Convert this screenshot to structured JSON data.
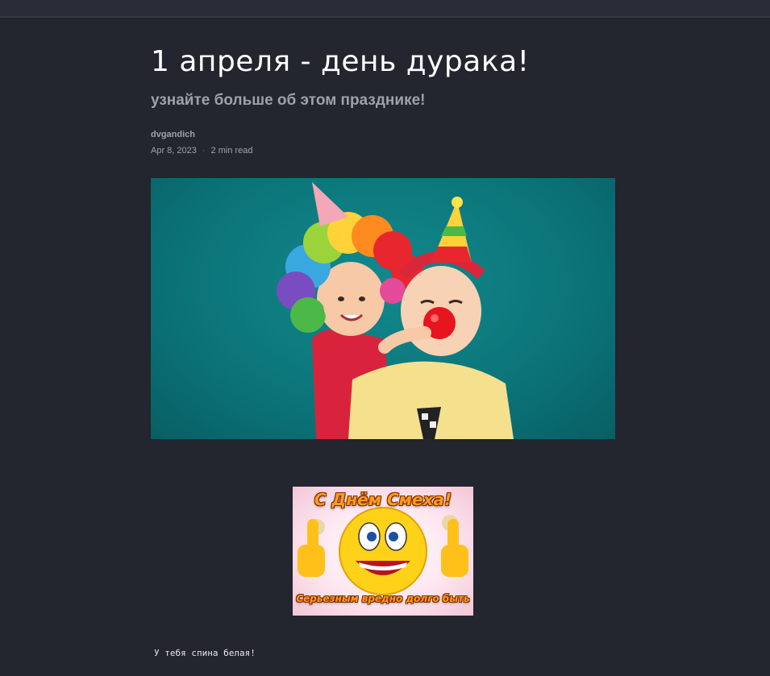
{
  "article": {
    "title": "1 апреля - день дурака!",
    "subtitle": "узнайте больше об этом празднике!",
    "author": "dvgandich",
    "date": "Apr 8, 2023",
    "separator": "·",
    "read_time": "2 min read",
    "body_text": "У тебя спина белая!"
  },
  "greeting_card": {
    "top_text": "С Днём Смеха!",
    "bottom_text": "Серьезным вредно долго быть"
  },
  "colors": {
    "page_background": "#23252f",
    "hero_background": "#0b7479",
    "card_text": "#ff9b1a"
  }
}
